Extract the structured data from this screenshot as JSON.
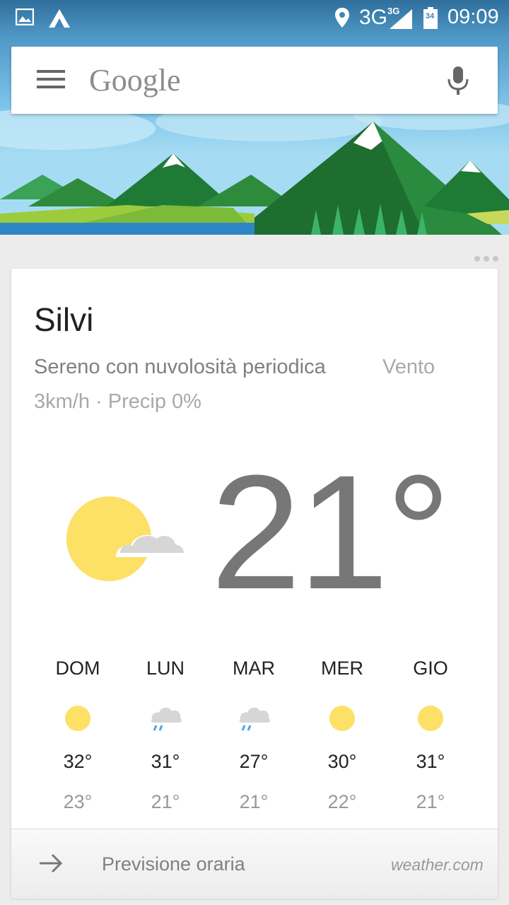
{
  "status_bar": {
    "network": "3G",
    "network_small": "3G",
    "battery": "34",
    "time": "09:09",
    "icons": [
      "gallery-icon",
      "app-icon",
      "location-icon",
      "signal-icon",
      "battery-icon"
    ]
  },
  "search": {
    "logo_text": "Google",
    "icons": [
      "menu-icon",
      "mic-icon"
    ]
  },
  "weather": {
    "city": "Silvi",
    "condition": "Sereno con nuvolosità periodica",
    "wind_label": "Vento",
    "wind_precip": "3km/h · Precip 0%",
    "temperature": "21°",
    "main_icon": "partly-sunny-icon",
    "forecast": [
      {
        "day": "DOM",
        "icon": "sun-icon",
        "high": "32°",
        "low": "23°"
      },
      {
        "day": "LUN",
        "icon": "rain-cloud-icon",
        "high": "31°",
        "low": "21°"
      },
      {
        "day": "MAR",
        "icon": "rain-cloud-icon",
        "high": "27°",
        "low": "21°"
      },
      {
        "day": "MER",
        "icon": "sun-icon",
        "high": "30°",
        "low": "22°"
      },
      {
        "day": "GIO",
        "icon": "sun-icon",
        "high": "31°",
        "low": "21°"
      }
    ]
  },
  "footer": {
    "link": "Previsione oraria",
    "provider": "weather.com"
  },
  "colors": {
    "sun": "#fde066",
    "cloud": "#d6d6d6",
    "sky": "#7ec4ea",
    "mountain": "#2e8b3c"
  }
}
